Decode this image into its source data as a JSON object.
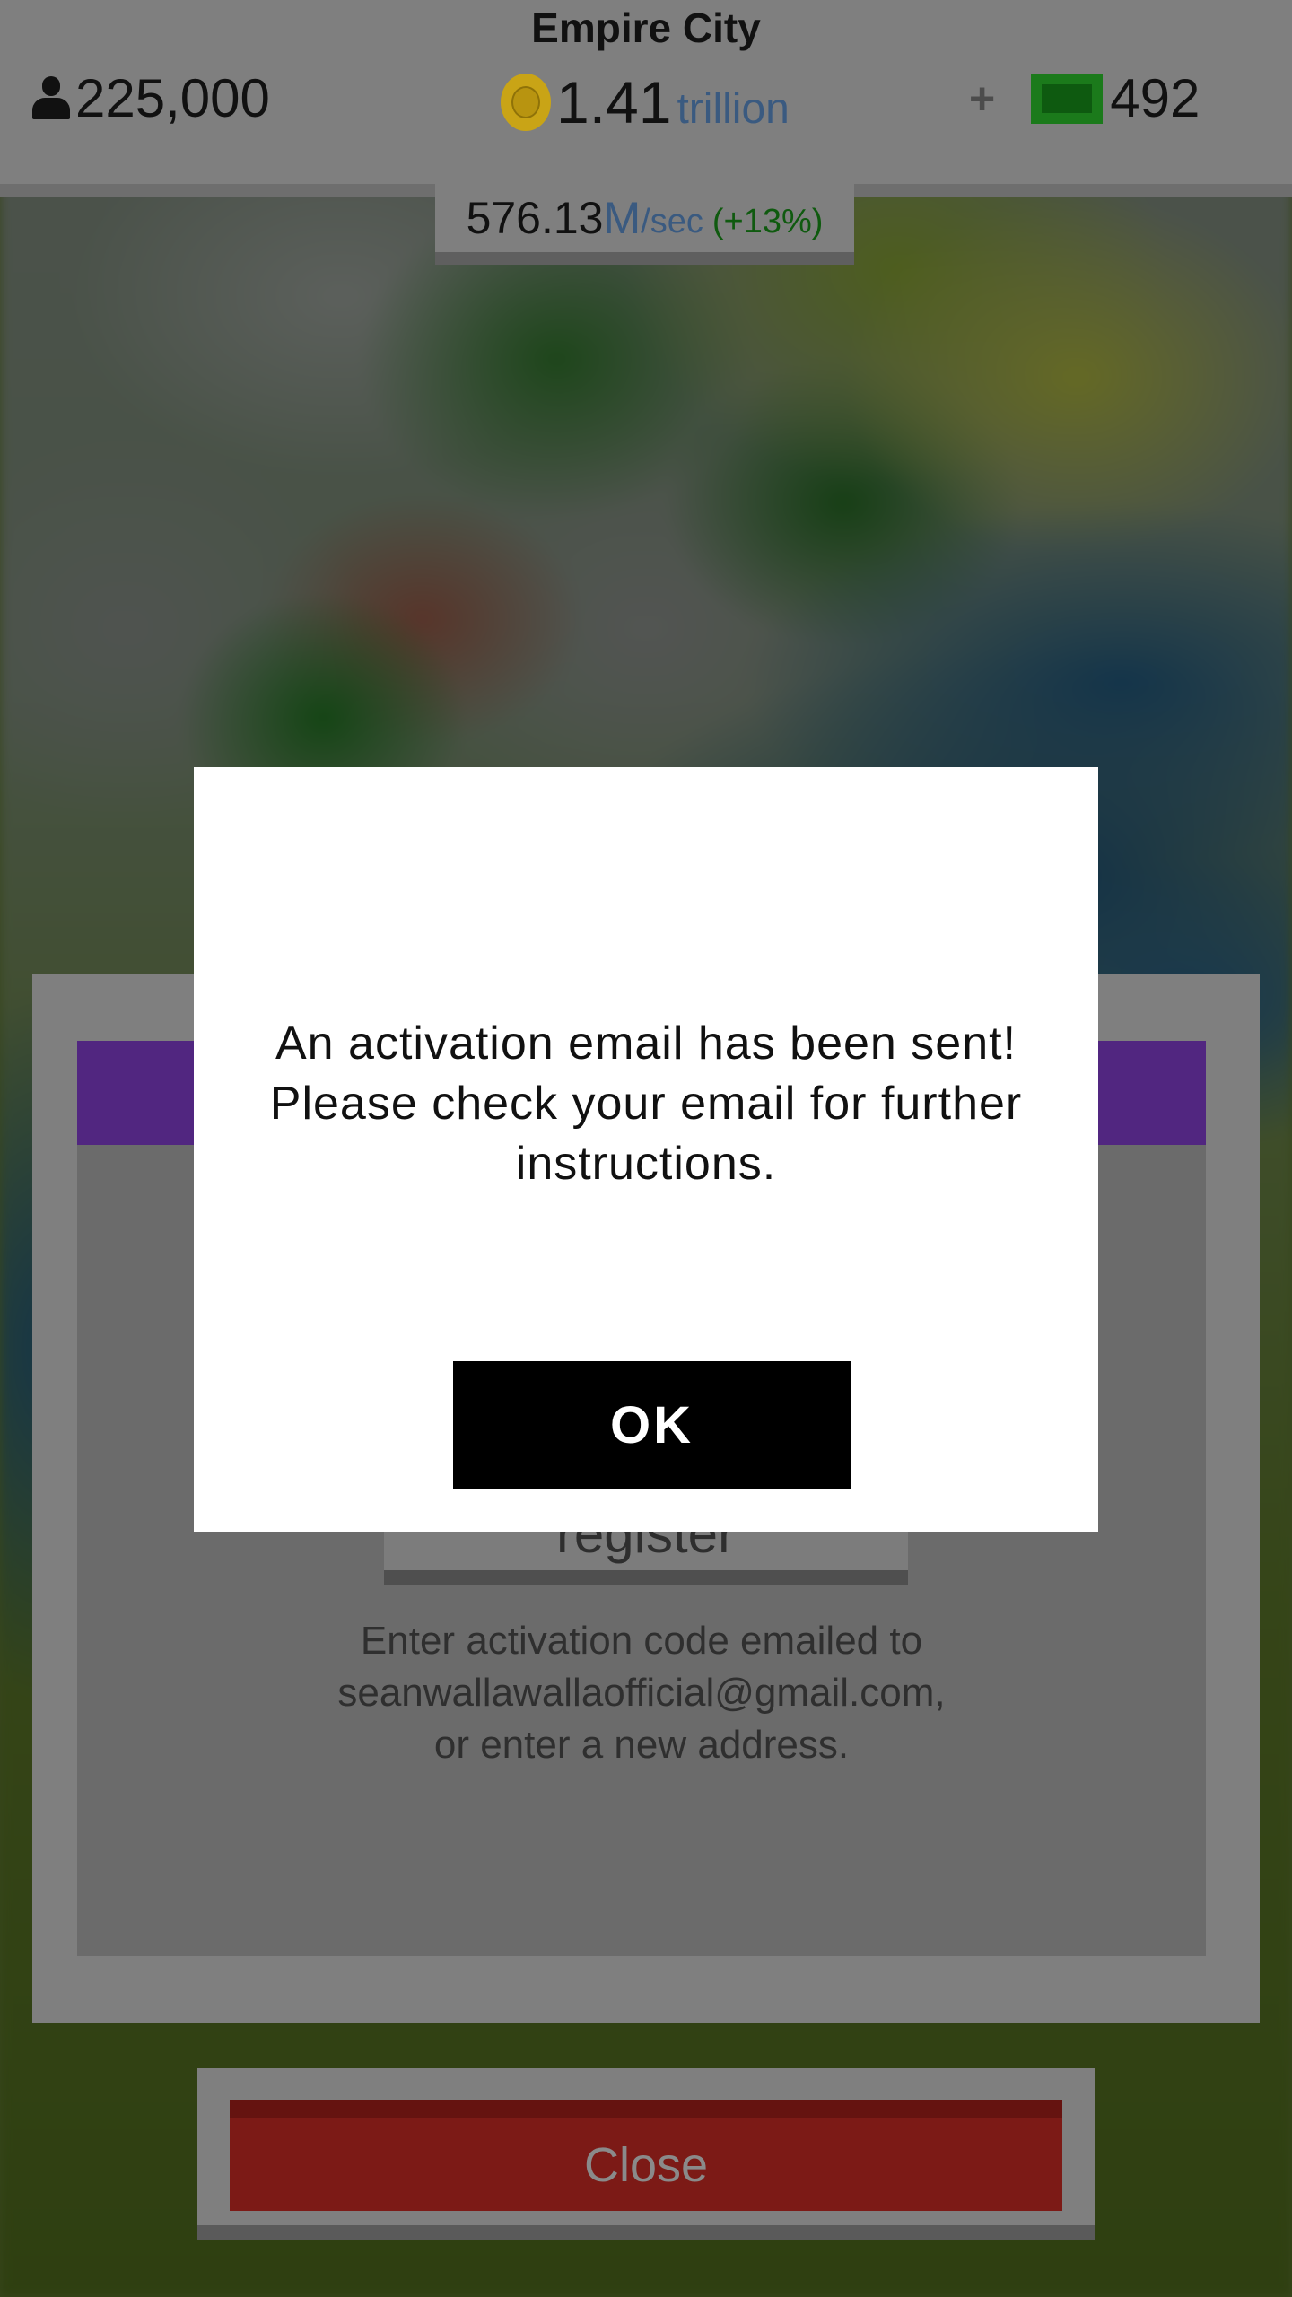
{
  "header": {
    "city_name": "Empire City",
    "population": "225,000",
    "coins": {
      "value": "1.41",
      "unit": "trillion"
    },
    "cash": "492",
    "plus_label": "+",
    "income": {
      "value": "576.13",
      "unit": "M",
      "per": "/sec",
      "bonus": "(+13%)"
    }
  },
  "register_panel": {
    "register_button_label": "register",
    "info_lines": [
      "Enter activation code emailed to",
      "seanwallawallaofficial@gmail.com,",
      "or enter a new address."
    ],
    "header_color": "#512680"
  },
  "close_button_label": "Close",
  "dialog": {
    "message_lines": [
      "An activation email has been sent!",
      "Please check your email for further",
      "instructions."
    ],
    "ok_label": "OK"
  },
  "icons": {
    "population": "person-icon",
    "coins": "coin-icon",
    "cash": "cash-icon",
    "add": "plus-icon"
  },
  "colors": {
    "close_button": "#7c1a16",
    "ok_button": "#000000",
    "coin_unit_text": "#3a5a80",
    "income_bonus_text": "#0f5a0f"
  }
}
